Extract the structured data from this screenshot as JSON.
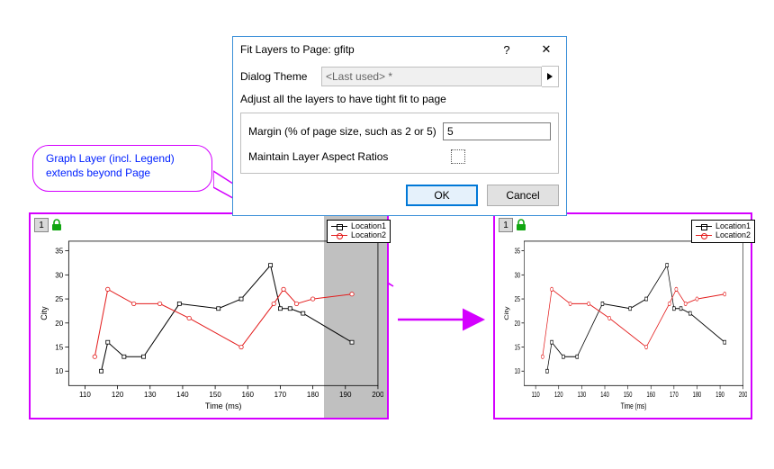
{
  "bubble": {
    "text": "Graph Layer (incl. Legend) extends beyond Page"
  },
  "dialog": {
    "title": "Fit Layers to Page: gfitp",
    "help_icon": "?",
    "close_icon": "✕",
    "theme_label": "Dialog Theme",
    "theme_value": "<Last used> *",
    "description": "Adjust all the layers to have tight fit to page",
    "margin_label": "Margin (% of page size, such as 2 or 5)",
    "margin_value": "5",
    "aspect_label": "Maintain Layer Aspect Ratios",
    "aspect_checked": false,
    "ok": "OK",
    "cancel": "Cancel"
  },
  "chart_common": {
    "layer_index": "1",
    "xlabel": "Time (ms)",
    "ylabel": "City",
    "legend": [
      "Location1",
      "Location2"
    ],
    "colors": {
      "s1": "#000000",
      "s2": "#e31b1b"
    }
  },
  "chart_data": [
    {
      "type": "line",
      "xlabel": "Time (ms)",
      "ylabel": "City",
      "xlim": [
        105,
        200
      ],
      "ylim": [
        7,
        37
      ],
      "xticks": [
        110,
        120,
        130,
        140,
        150,
        160,
        170,
        180,
        190,
        200
      ],
      "yticks": [
        10,
        15,
        20,
        25,
        30,
        35
      ],
      "series": [
        {
          "name": "Location1",
          "color": "#000000",
          "x": [
            115,
            117,
            122,
            128,
            139,
            151,
            158,
            167,
            170,
            173,
            177,
            192
          ],
          "y": [
            10,
            16,
            13,
            13,
            24,
            23,
            25,
            32,
            23,
            23,
            22,
            16
          ]
        },
        {
          "name": "Location2",
          "color": "#e31b1b",
          "x": [
            113,
            117,
            125,
            133,
            142,
            158,
            168,
            171,
            175,
            180,
            192
          ],
          "y": [
            13,
            27,
            24,
            24,
            21,
            15,
            24,
            27,
            24,
            25,
            26
          ]
        }
      ],
      "note": "left panel — layer extends beyond page causing grey overflow band on right side"
    },
    {
      "type": "line",
      "xlabel": "Time (ms)",
      "ylabel": "City",
      "xlim": [
        105,
        200
      ],
      "ylim": [
        7,
        37
      ],
      "xticks": [
        110,
        120,
        130,
        140,
        150,
        160,
        170,
        180,
        190,
        200
      ],
      "yticks": [
        10,
        15,
        20,
        25,
        30,
        35
      ],
      "series": [
        {
          "name": "Location1",
          "color": "#000000",
          "x": [
            115,
            117,
            122,
            128,
            139,
            151,
            158,
            167,
            170,
            173,
            177,
            192
          ],
          "y": [
            10,
            16,
            13,
            13,
            24,
            23,
            25,
            32,
            23,
            23,
            22,
            16
          ]
        },
        {
          "name": "Location2",
          "color": "#e31b1b",
          "x": [
            113,
            117,
            125,
            133,
            142,
            158,
            168,
            171,
            175,
            180,
            192
          ],
          "y": [
            13,
            27,
            24,
            24,
            21,
            15,
            24,
            27,
            24,
            25,
            26
          ]
        }
      ],
      "note": "right panel — same data after Fit Layers to Page applied"
    }
  ]
}
